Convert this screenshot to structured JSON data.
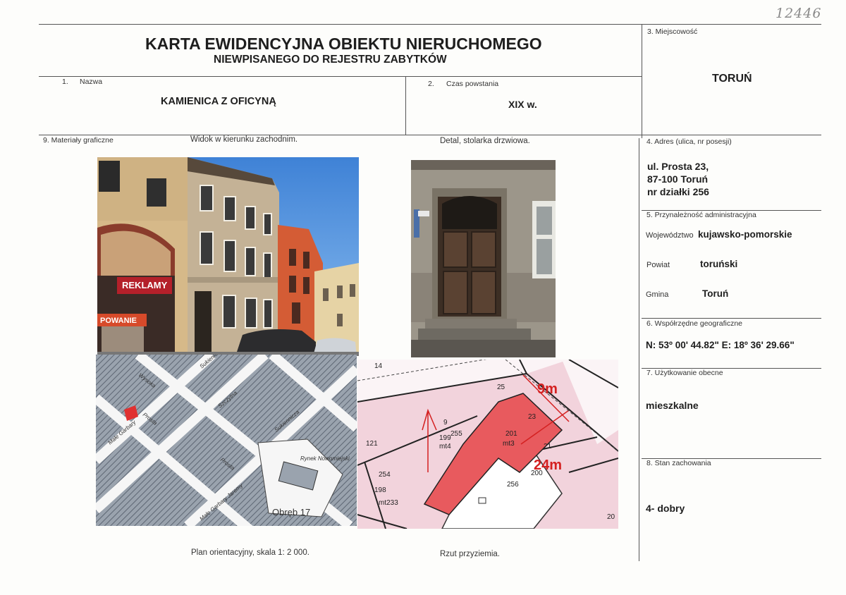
{
  "handwritten_number": "12446",
  "header": {
    "title": "KARTA EWIDENCYJNA OBIEKTU NIERUCHOMEGO",
    "subtitle": "NIEWPISANEGO DO REJESTRU ZABYTKÓW"
  },
  "fields": {
    "name": {
      "label_num": "1.",
      "label": "Nazwa",
      "value": "KAMIENICA Z OFICYNĄ"
    },
    "time": {
      "label_num": "2.",
      "label": "Czas powstania",
      "value": "XIX w."
    },
    "locality": {
      "label": "3. Miejscowość",
      "value": "TORUŃ"
    },
    "address": {
      "label": "4. Adres (ulica, nr posesji)",
      "line1": "ul. Prosta 23,",
      "line2": "87-100 Toruń",
      "line3": "nr działki 256"
    },
    "admin": {
      "label": "5. Przynależność administracyjna",
      "voivodeship_label": "Województwo",
      "voivodeship": "kujawsko-pomorskie",
      "county_label": "Powiat",
      "county": "toruński",
      "commune_label": "Gmina",
      "commune": "Toruń"
    },
    "coords": {
      "label": "6. Współrzędne geograficzne",
      "value": "N: 53º 00' 44.82\" E: 18º 36' 29.66\""
    },
    "usage": {
      "label": "7. Użytkowanie obecne",
      "value": "mieszkalne"
    },
    "condition": {
      "label": "8. Stan zachowania",
      "value": "4- dobry"
    },
    "graphics": {
      "label": "9. Materiały graficzne"
    }
  },
  "captions": {
    "photo1": "Widok w kierunku zachodnim.",
    "photo2": "Detal, stolarka drzwiowa.",
    "map1": "Plan orientacyjny, skala 1: 2 000.",
    "map2": "Rzut przyziemia."
  },
  "photo1_signs": {
    "sign1": "REKLAMY",
    "sign2": "POWANIE"
  },
  "map1_labels": {
    "obreb": "Obręb 17",
    "rynek": "Rynek Nowomiejski",
    "prosta1": "Prosta",
    "prosta2": "Prosta",
    "male_garbary": "Małe Garbary",
    "sukiennicza1": "Sukiennicza",
    "sukiennicza2": "Sukiennicza",
    "wysoka": "Wysoka",
    "szczytna": "Szczytna",
    "male_garbary2": "Małe Garbary Jaremy"
  },
  "map2_labels": {
    "p14": "14",
    "p25": "25",
    "p9": "9",
    "p255": "255",
    "p199": "199",
    "mt4": "mt4",
    "p201": "201",
    "mt3": "mt3",
    "p23": "23",
    "p21": "21",
    "p200": "200",
    "p121": "121",
    "p254": "254",
    "p198": "198",
    "mt233": "mt233",
    "p256": "256",
    "p20": "20",
    "m9": "9m",
    "m24": "24m"
  },
  "colors": {
    "plot_red": "#e85a5e",
    "plot_pink": "#f2d3dc",
    "dimension_red": "#d42020",
    "line_gray": "#555555"
  }
}
